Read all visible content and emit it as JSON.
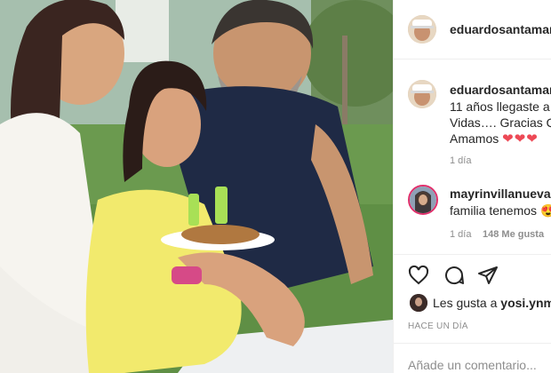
{
  "post": {
    "author": "eduardosantamarina",
    "author_short": "eduardosantamarin",
    "caption_line1": "11 años llegaste a m",
    "caption_line2": "Vidas…. Gracias Qu",
    "caption_line3": "Amamos",
    "caption_hearts": "❤❤❤",
    "caption_time": "1 día"
  },
  "comment": {
    "user": "mayrinvillanueva",
    "text": "familia tenemos",
    "emoji": "😍",
    "time": "1 día",
    "likes": "148 Me gusta"
  },
  "likes": {
    "prefix": "Les gusta a",
    "user": "yosi.ynm",
    "suffix": "y"
  },
  "post_time": "HACE UN DÍA",
  "add_comment_placeholder": "Añade un comentario...",
  "icons": {
    "like": "heart-icon",
    "comment": "comment-icon",
    "share": "share-icon",
    "verified": "verified-badge-icon"
  },
  "colors": {
    "verified": "#3897f0",
    "heart": "#ed4956",
    "muted": "#8e8e8e"
  }
}
